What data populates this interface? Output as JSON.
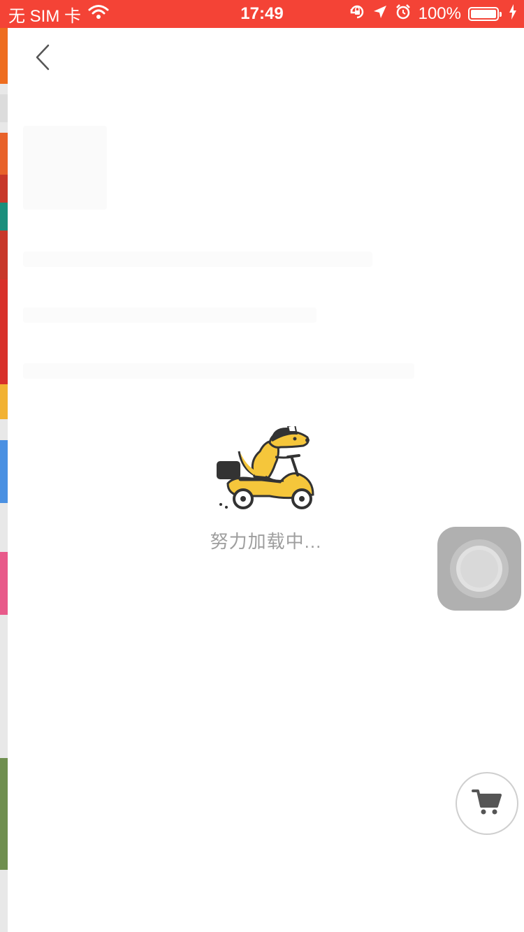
{
  "status_bar": {
    "carrier": "无 SIM 卡",
    "time": "17:49",
    "battery": "100%",
    "background_color": "#f44336",
    "icons": [
      "wifi-icon",
      "orientation-lock-icon",
      "location-arrow-icon",
      "alarm-icon",
      "battery-icon",
      "charging-bolt-icon"
    ]
  },
  "nav": {
    "back_icon": "chevron-left-icon"
  },
  "loading": {
    "text": "努力加载中...",
    "illustration": "kangaroo-on-scooter",
    "accent_color": "#f5c63b"
  },
  "floating": {
    "assistive_touch": "assistive-touch-button",
    "cart_icon": "shopping-cart-icon"
  }
}
